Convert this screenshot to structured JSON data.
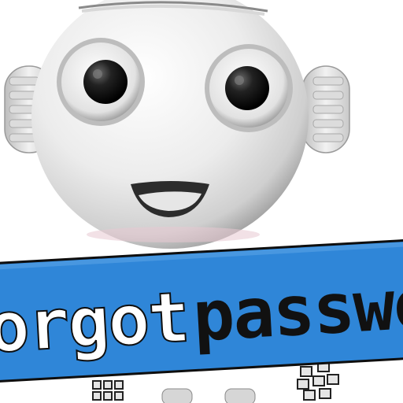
{
  "banner": {
    "text_part_1": "orgot",
    "text_part_2": "passwor",
    "background_color": "#2f86d8",
    "text_color_1": "#ffffff",
    "text_color_2": "#111111",
    "border_color": "#0e0e0e"
  },
  "character": {
    "icon": "robot-mascot-icon",
    "body_color": "#e9e9e9",
    "eye_color": "#1a1a1a"
  }
}
